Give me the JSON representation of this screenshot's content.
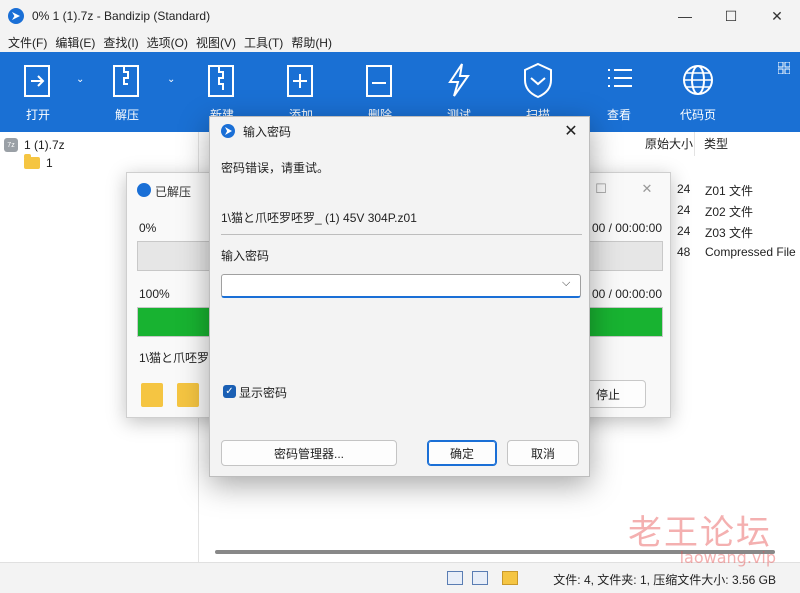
{
  "window": {
    "title": "0% 1 (1).7z - Bandizip (Standard)",
    "controls": [
      "—",
      "☐",
      "✕"
    ]
  },
  "menu": [
    "文件(F)",
    "编辑(E)",
    "查找(I)",
    "选项(O)",
    "视图(V)",
    "工具(T)",
    "帮助(H)"
  ],
  "toolbar": {
    "open": "打开",
    "extract": "解压",
    "new": "新建",
    "add": "添加",
    "delete": "删除",
    "test": "测试",
    "scan": "扫描",
    "view": "查看",
    "codepage": "代码页"
  },
  "tree": {
    "archive": "1 (1).7z",
    "folder": "1"
  },
  "filelist": {
    "columns": [
      "原始大小",
      "类型"
    ],
    "rows": [
      {
        "size": "24",
        "type": "Z01 文件"
      },
      {
        "size": "24",
        "type": "Z02 文件"
      },
      {
        "size": "24",
        "type": "Z03 文件"
      },
      {
        "size": "48",
        "type": "Compressed File"
      }
    ]
  },
  "statusbar": {
    "text": "文件: 4, 文件夹: 1, 压缩文件大小: 3.56 GB"
  },
  "progress_dialog": {
    "title": "已解压",
    "pct1": "0%",
    "time1": "00 / 00:00:00",
    "pct2": "100%",
    "time2": "00 / 00:00:00",
    "progress1": 0,
    "progress2": 1.0,
    "current_file": "1\\猫と爪呸罗",
    "stop": "停止"
  },
  "password_dialog": {
    "title": "输入密码",
    "error": "密码错误，请重试。",
    "filename": "1\\猫と爪呸罗呸罗_ (1) 45V 304P.z01",
    "input_label": "输入密码",
    "input_value": "",
    "show_password": "显示密码",
    "manager_button": "密码管理器...",
    "ok_button": "确定",
    "cancel_button": "取消"
  },
  "watermark": {
    "line1": "老王论坛",
    "line2": "laowang.vip"
  },
  "colors": {
    "toolbar": "#1a70d4",
    "progress_green": "#18b331",
    "accent": "#1a6fd6"
  }
}
